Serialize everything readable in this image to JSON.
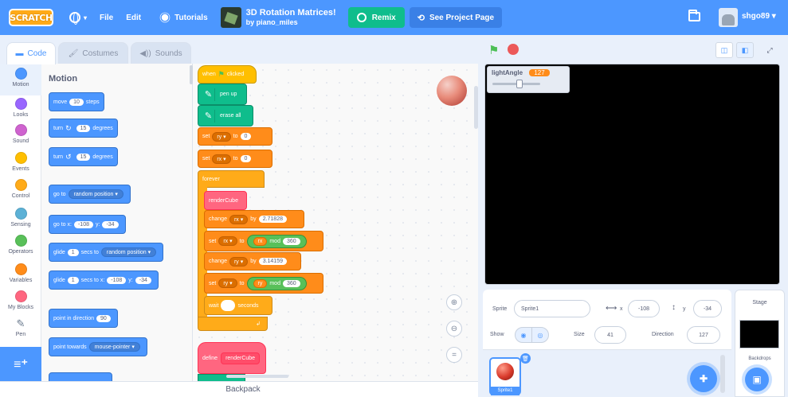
{
  "menubar": {
    "logo": "SCRATCH",
    "file": "File",
    "edit": "Edit",
    "tutorials": "Tutorials",
    "project_title": "3D Rotation Matrices!",
    "project_author": "by piano_miles",
    "remix": "Remix",
    "see_project_page": "See Project Page",
    "username": "shgo89"
  },
  "tabs": {
    "code": "Code",
    "costumes": "Costumes",
    "sounds": "Sounds"
  },
  "categories": [
    {
      "label": "Motion",
      "color": "#4c97ff"
    },
    {
      "label": "Looks",
      "color": "#9966ff"
    },
    {
      "label": "Sound",
      "color": "#cf63cf"
    },
    {
      "label": "Events",
      "color": "#ffbf00"
    },
    {
      "label": "Control",
      "color": "#ffab19"
    },
    {
      "label": "Sensing",
      "color": "#5cb1d6"
    },
    {
      "label": "Operators",
      "color": "#59c059"
    },
    {
      "label": "Variables",
      "color": "#ff8c1a"
    },
    {
      "label": "My Blocks",
      "color": "#ff6680"
    },
    {
      "label": "Pen",
      "color": "#0fbd8c"
    }
  ],
  "palette": {
    "title": "Motion",
    "move": {
      "a": "move",
      "n": "10",
      "b": "steps"
    },
    "turn_right": {
      "a": "turn",
      "n": "15",
      "b": "degrees"
    },
    "turn_left": {
      "a": "turn",
      "n": "15",
      "b": "degrees"
    },
    "goto": {
      "a": "go to",
      "d": "random position"
    },
    "gotoxy": {
      "a": "go to x:",
      "x": "-108",
      "yl": "y:",
      "y": "-34"
    },
    "glide1": {
      "a": "glide",
      "n": "1",
      "b": "secs to",
      "d": "random position"
    },
    "glide2": {
      "a": "glide",
      "n": "1",
      "b": "secs to x:",
      "x": "-108",
      "yl": "y:",
      "y": "-34"
    },
    "point_dir": {
      "a": "point in direction",
      "n": "90"
    },
    "point_towards": {
      "a": "point towards",
      "d": "mouse-pointer"
    }
  },
  "script": {
    "when_clicked": {
      "a": "when",
      "b": "clicked"
    },
    "pen_up": "pen up",
    "erase_all": "erase all",
    "set_ry": {
      "a": "set",
      "v": "ry",
      "b": "to",
      "n": "0"
    },
    "set_rx": {
      "a": "set",
      "v": "rx",
      "b": "to",
      "n": "0"
    },
    "forever": "forever",
    "render_cube": "renderCube",
    "change_rx": {
      "a": "change",
      "v": "rx",
      "b": "by",
      "n": "2.71828"
    },
    "set_rx_mod": {
      "a": "set",
      "v": "rx",
      "b": "to",
      "r": "rx",
      "m": "mod",
      "n": "360"
    },
    "change_ry": {
      "a": "change",
      "v": "ry",
      "b": "by",
      "n": "3.14159"
    },
    "set_ry_mod": {
      "a": "set",
      "v": "ry",
      "b": "to",
      "r": "ry",
      "m": "mod",
      "n": "360"
    },
    "wait": {
      "a": "wait",
      "b": "seconds"
    },
    "define": {
      "a": "define",
      "b": "renderCube"
    }
  },
  "backpack": "Backpack",
  "monitor": {
    "label": "lightAngle",
    "value": "127"
  },
  "sprite_info": {
    "sprite_label": "Sprite",
    "sprite_name": "Sprite1",
    "x_label": "x",
    "x": "-108",
    "y_label": "y",
    "y": "-34",
    "show_label": "Show",
    "size_label": "Size",
    "size": "41",
    "direction_label": "Direction",
    "direction": "127"
  },
  "sprite_list": [
    {
      "name": "Sprite1"
    }
  ],
  "stage_pane": {
    "title": "Stage",
    "backdrops": "Backdrops"
  }
}
